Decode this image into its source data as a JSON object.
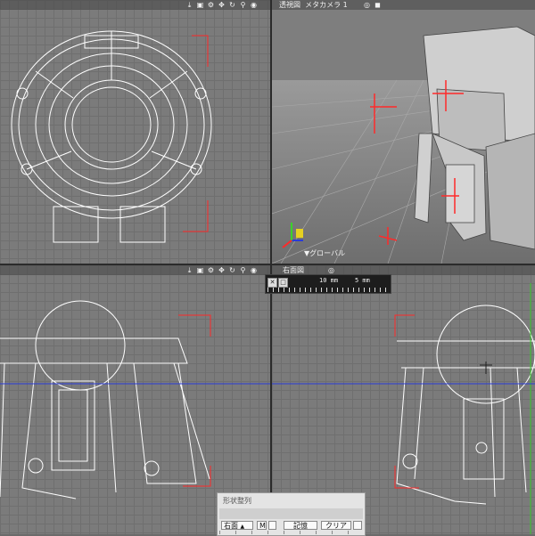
{
  "viewports": {
    "perspective": {
      "title": "透視図",
      "camera": "メタカメラ 1",
      "coord_label": "▼グローバル"
    },
    "right": {
      "title": "右面図"
    }
  },
  "icons": {
    "toolbar": [
      "lock-icon",
      "image-icon",
      "gear-icon",
      "move-icon",
      "rotate-icon",
      "zoom-icon",
      "reset-icon"
    ],
    "perspective_extra": [
      "target-icon",
      "cube-icon"
    ]
  },
  "ruler": {
    "label_a": "10 mm",
    "label_b": "5 mm"
  },
  "panel": {
    "title": "形状整列",
    "view_select": "右面",
    "m_button": "M",
    "store_button": "記憶",
    "clear_button": "クリア"
  },
  "colors": {
    "viewport_bg": "#7b7b7b",
    "wire": "#ffffff",
    "marker_red": "#ff2a2a",
    "axis_blue": "#2a3bd8",
    "axis_green": "#3ad22a"
  }
}
